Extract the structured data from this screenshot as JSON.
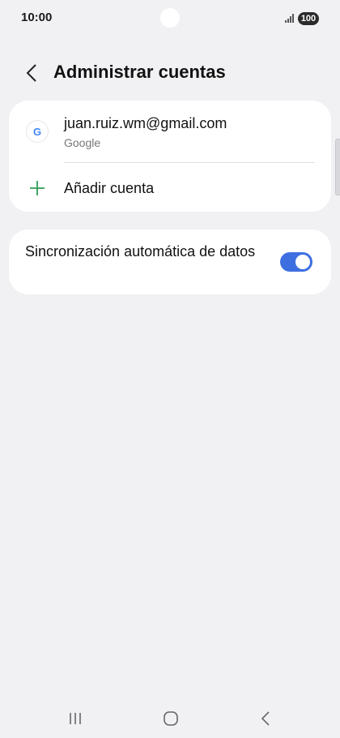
{
  "status_bar": {
    "time": "10:00",
    "battery": "100"
  },
  "header": {
    "title": "Administrar cuentas"
  },
  "accounts": [
    {
      "email": "juan.ruiz.wm@gmail.com",
      "provider": "Google",
      "icon": "google-icon",
      "icon_letter": "G"
    }
  ],
  "add_account": {
    "label": "Añadir cuenta",
    "icon": "plus-icon"
  },
  "auto_sync": {
    "label": "Sincronización automática de datos",
    "enabled": true
  },
  "colors": {
    "toggle_on": "#3e6fe0",
    "plus": "#2e9e57",
    "google_blue": "#4285f4",
    "background": "#f1f1f3"
  }
}
